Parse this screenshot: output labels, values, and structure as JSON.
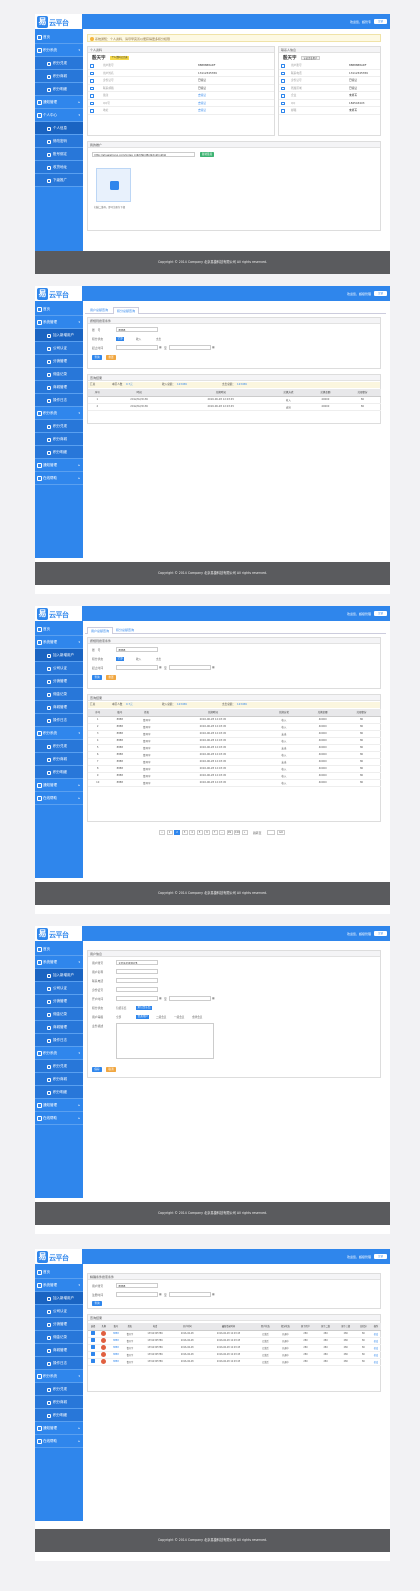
{
  "brand": "云平台",
  "logo_glyph": "易",
  "welcome": "欢迎您，超级管理",
  "welcome_short": "欢迎您，超管专",
  "logout": "注销",
  "footer": "Copyright © 2014 Company 北京易捷科技有限公司 All rights reserved.",
  "nav": {
    "home": "首页",
    "credit": "积分系统",
    "cash": "积分兑现",
    "record": "积分商城",
    "detail": "积分明细",
    "notice": "通知管理",
    "personal": "个人中心",
    "myinfo": "个人信息",
    "pwd": "修改密码",
    "bind": "账号绑定",
    "addr": "收货地址",
    "lower": "下级推广",
    "system": "系统管理",
    "add_user": "加入新增用户",
    "contract": "公司认证",
    "agent": "分销管理",
    "commission": "佣金记录",
    "shop": "商城管理",
    "log": "操作日志",
    "help": "在线帮助"
  },
  "s1": {
    "warn": "系统通知：个人资料、请尽早完善以便获得更多积分权限",
    "personal_title": "个人资料",
    "contact_title": "联系人信息",
    "name": "殷天宇",
    "badge": "个人资料已完善",
    "right_name": "殷天宇",
    "right_badge": "认证企业用户",
    "left_rows": [
      {
        "l": "用户账号",
        "v": "8888888ADF"
      },
      {
        "l": "用户姓名",
        "v": "13112345789"
      },
      {
        "l": "身份证号",
        "v": "已验证"
      },
      {
        "l": "联系邮箱",
        "v": "已验证"
      },
      {
        "l": "备注",
        "v": "去验证"
      },
      {
        "l": "QQ号",
        "v": "去验证"
      },
      {
        "l": "地址",
        "v": "去验证"
      }
    ],
    "right_rows": [
      {
        "l": "用户账号",
        "v": "8888888ADF"
      },
      {
        "l": "联系电话",
        "v": "13112345789"
      },
      {
        "l": "身份证号",
        "v": "已验证"
      },
      {
        "l": "所属区域",
        "v": "已验证"
      },
      {
        "l": "企业",
        "v": "未填写"
      },
      {
        "l": "QQ",
        "v": "1845434X3"
      },
      {
        "l": "邮箱",
        "v": "未填写"
      }
    ],
    "share_title": "我的推广",
    "share_url": "http://shuaishong.com/index_kdkhfkkdfkdkdnkhnkhkj",
    "copy_btn": "复制链接",
    "qr_caption": "扫描二维码，即可注册为下级"
  },
  "s2": {
    "tab1": "用户总额查询",
    "tab2": "积分总额查询",
    "filter_title": "按规则搜索条件",
    "f_name": "账　号",
    "f_name_v": "8888",
    "f_type": "积分状态",
    "r_all": "全部",
    "r_in": "收入",
    "r_out": "支出",
    "f_date": "起止时间",
    "to": "至",
    "search": "查询",
    "reset": "重置",
    "result_title": "查询结果",
    "sum": [
      {
        "l": "汇总",
        "v": ""
      },
      {
        "l": "本区人数",
        "v": "0.7元"
      },
      {
        "l": "收入总额：",
        "v": "123456"
      },
      {
        "l": "支出总额：",
        "v": "123456"
      }
    ],
    "cols": [
      "序号",
      "时间",
      "兑换时间",
      "兑换方式",
      "兑换金额",
      "兑现积分"
    ],
    "rows": [
      [
        "1",
        "2012/02/2136",
        "2016-06-28 12:03:45",
        "收入",
        "40000",
        "80"
      ],
      [
        "2",
        "2012/02/2136",
        "2016-06-28 12:03:45",
        "支出",
        "40000",
        "80"
      ]
    ]
  },
  "s3": {
    "cols": [
      "序号",
      "账号",
      "姓名",
      "兑换时间",
      "兑换方式",
      "兑换金额",
      "兑现积分"
    ],
    "rows": [
      [
        "1",
        "8888",
        "曹开宇",
        "2016-06-28 12:03:45",
        "收入",
        "40000",
        "80"
      ],
      [
        "2",
        "8888",
        "曹开宇",
        "2016-06-28 12:03:45",
        "收入",
        "40000",
        "80"
      ],
      [
        "3",
        "8888",
        "曹开宇",
        "2016-06-28 12:03:45",
        "支出",
        "40000",
        "80"
      ],
      [
        "4",
        "8888",
        "曹开宇",
        "2016-06-28 12:03:45",
        "收入",
        "40000",
        "80"
      ],
      [
        "5",
        "8888",
        "曹开宇",
        "2016-06-28 12:03:45",
        "支出",
        "40000",
        "80"
      ],
      [
        "6",
        "8888",
        "曹开宇",
        "2016-06-28 12:03:45",
        "收入",
        "40000",
        "80"
      ],
      [
        "7",
        "8888",
        "曹开宇",
        "2016-06-28 12:03:45",
        "支出",
        "40000",
        "80"
      ],
      [
        "8",
        "8888",
        "曹开宇",
        "2016-06-28 12:03:45",
        "收入",
        "40000",
        "80"
      ],
      [
        "9",
        "8888",
        "曹开宇",
        "2016-06-28 12:03:45",
        "收入",
        "40000",
        "80"
      ],
      [
        "10",
        "8888",
        "曹开宇",
        "2016-06-28 12:03:45",
        "收入",
        "40000",
        "80"
      ]
    ],
    "pages": [
      "«",
      "1",
      "2",
      "3",
      "4",
      "5",
      "6",
      "7",
      "...",
      "99",
      "100",
      "»"
    ],
    "goto": "跳转至",
    "go": "GO"
  },
  "s4": {
    "title": "用户信息",
    "rows": [
      "用户账号",
      "用户名称",
      "联系电话",
      "身份证号",
      "开户时间",
      "积分状态",
      "用户等级",
      "业务描述"
    ],
    "acct": "13312345678",
    "to": "至",
    "status_opts": [
      "包括冻结",
      "未包含冻结"
    ],
    "level_opts": [
      "全部",
      "普通用户",
      "二级会员",
      "一级会员",
      "金牌会员"
    ],
    "save": "保存",
    "cancel": "取消"
  },
  "s5": {
    "title": "精确条件搜索条件",
    "f1": "用户账号",
    "f1v": "8888",
    "f2": "注册时间",
    "to": "至",
    "search": "查询",
    "result": "查询结果",
    "cols": [
      "选择",
      "头像",
      "账号",
      "姓名",
      "电话",
      "开户时间",
      "最新登录时间",
      "用户状态",
      "积分状态",
      "原下用户",
      "原下二级",
      "原下三级",
      "总积分",
      "操作"
    ],
    "rows": [
      [
        "",
        "",
        "8888",
        "曹开宇",
        "13312345789",
        "2016-06-28",
        "2016-06-28 12:03:45",
        "已激活",
        "开通中",
        "280",
        "280",
        "280",
        "80",
        "修改"
      ],
      [
        "",
        "",
        "8888",
        "曹开宇",
        "13312345789",
        "2016-06-28",
        "2016-06-28 12:03:45",
        "已激活",
        "开通中",
        "280",
        "280",
        "280",
        "80",
        "修改"
      ],
      [
        "",
        "",
        "8888",
        "曹开宇",
        "13312345789",
        "2016-06-28",
        "2016-06-28 12:03:45",
        "已激活",
        "开通中",
        "280",
        "280",
        "280",
        "80",
        "修改"
      ],
      [
        "",
        "",
        "8888",
        "曹开宇",
        "13312345789",
        "2016-06-28",
        "2016-06-28 12:03:45",
        "已激活",
        "开通中",
        "280",
        "280",
        "280",
        "80",
        "修改"
      ],
      [
        "",
        "",
        "8888",
        "曹开宇",
        "13312345789",
        "2016-06-28",
        "2016-06-28 12:03:45",
        "已激活",
        "开通中",
        "280",
        "280",
        "280",
        "80",
        "修改"
      ]
    ]
  },
  "colors": {
    "accent": "#2f86ec",
    "footer": "#5a5b5e",
    "warn": "#fdf9e3",
    "orange": "#f0a640",
    "green": "#3cb371"
  }
}
